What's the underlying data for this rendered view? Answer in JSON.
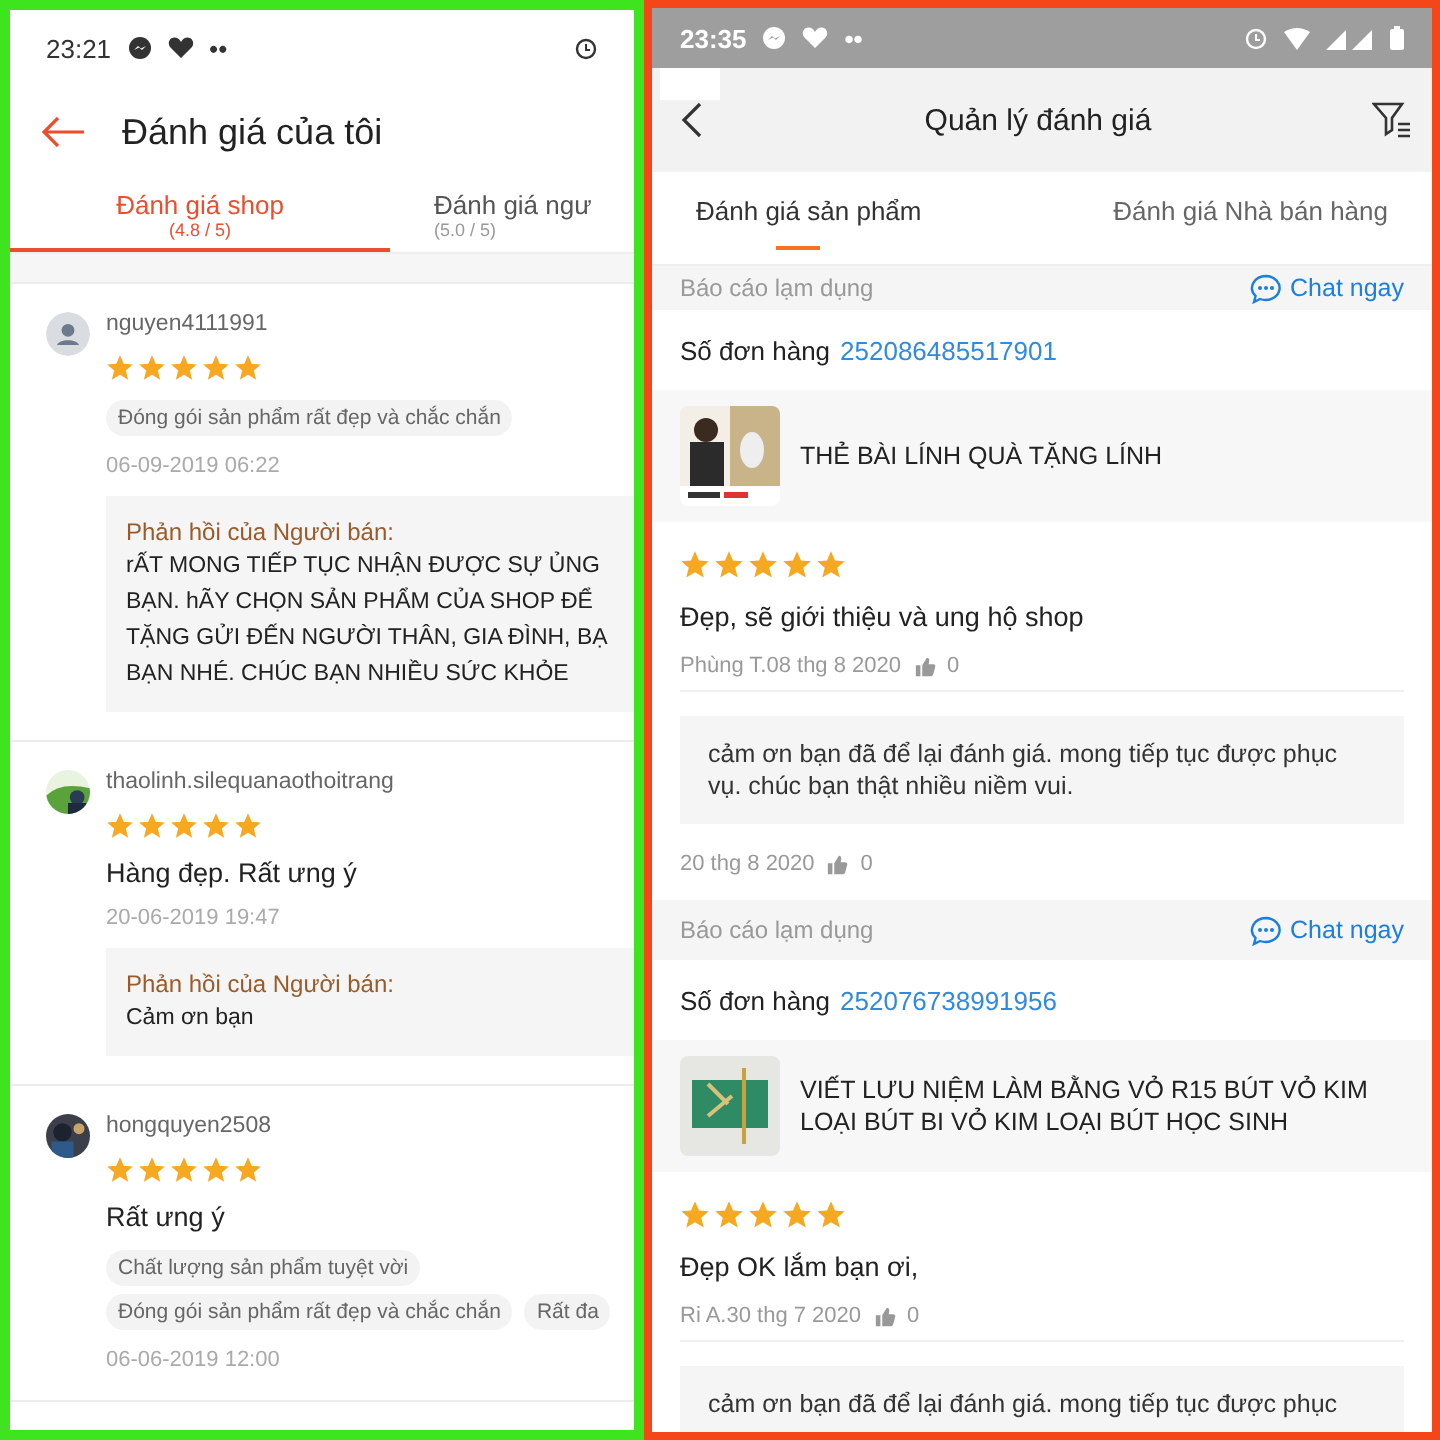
{
  "left_screen": {
    "status_bar": {
      "time": "23:21",
      "dots": "••"
    },
    "header": {
      "title": "Đánh giá của tôi"
    },
    "tabs": [
      {
        "label": "Đánh giá shop",
        "rating": "(4.8 / 5)",
        "selected": true
      },
      {
        "label": "Đánh giá ngư",
        "rating": "(5.0 / 5)",
        "selected": false
      }
    ],
    "reviews": [
      {
        "user": "nguyen4111991",
        "avatar": {
          "kind": "icon"
        },
        "stars": 5,
        "tag_rows": [
          [
            "Đóng gói sản phẩm rất đẹp và chắc chắn"
          ]
        ],
        "date": "06-09-2019 06:22",
        "reply": {
          "label": "Phản hồi của Người bán:",
          "lines": [
            "rẤT MONG TIẾP TỤC NHẬN ĐƯỢC SỰ ỦNG",
            "BẠN. hÃY CHỌN SẢN PHẨM CỦA SHOP ĐỂ",
            "TẶNG GỬI ĐẾN NGƯỜI THÂN, GIA ĐÌNH, BẠ",
            "BẠN NHÉ. CHÚC BẠN NHIỀU SỨC KHỎE"
          ]
        }
      },
      {
        "user": "thaolinh.silequanaothoitrang",
        "avatar": {
          "kind": "picture"
        },
        "stars": 5,
        "comment": "Hàng đẹp. Rất ưng ý",
        "date": "20-06-2019 19:47",
        "reply": {
          "label": "Phản hồi của Người bán:",
          "lines": [
            "Cảm ơn bạn"
          ]
        }
      },
      {
        "user": "hongquyen2508",
        "avatar": {
          "kind": "picture"
        },
        "stars": 5,
        "comment": "Rất ưng ý",
        "tag_rows": [
          [
            "Chất lượng sản phẩm tuyệt vời"
          ],
          [
            "Đóng gói sản phẩm rất đẹp và chắc chắn",
            "Rất đa"
          ]
        ],
        "date": "06-06-2019 12:00"
      }
    ]
  },
  "right_screen": {
    "status_bar": {
      "time": "23:35",
      "dots": "••"
    },
    "header": {
      "title": "Quản lý đánh giá"
    },
    "tabs": [
      {
        "label": "Đánh giá sản phẩm",
        "selected": true
      },
      {
        "label": "Đánh giá Nhà bán hàng",
        "selected": false
      }
    ],
    "reviews": [
      {
        "report": "Báo cáo lạm dụng",
        "chat": "Chat ngay",
        "order_label": "Số đơn hàng",
        "order_number": "252086485517901",
        "product": "THẺ BÀI LÍNH QUÀ TẶNG LÍNH",
        "stars": 5,
        "comment": "Đẹp, sẽ giới thiệu và ung hộ shop",
        "byline": "Phùng T.08 thg 8 2020",
        "likes": "0",
        "reply": "cảm ơn bạn đã để lại đánh giá. mong tiếp tục được phục vụ. chúc bạn thật nhiều niềm vui.",
        "reply_date": "20 thg 8 2020",
        "reply_likes": "0"
      },
      {
        "report": "Báo cáo lạm dụng",
        "chat": "Chat ngay",
        "order_label": "Số đơn hàng",
        "order_number": "252076738991956",
        "product": "VIẾT LƯU NIỆM LÀM BẰNG VỎ  R15  BÚT VỎ KIM LOẠI  BÚT BI VỎ KIM LOẠI  BÚT HỌC SINH",
        "stars": 5,
        "comment": "Đẹp OK lắm bạn ơi,",
        "byline": "Ri A.30 thg 7 2020",
        "likes": "0",
        "reply": "cảm ơn bạn đã để lại đánh giá. mong tiếp tục được phục"
      }
    ]
  }
}
